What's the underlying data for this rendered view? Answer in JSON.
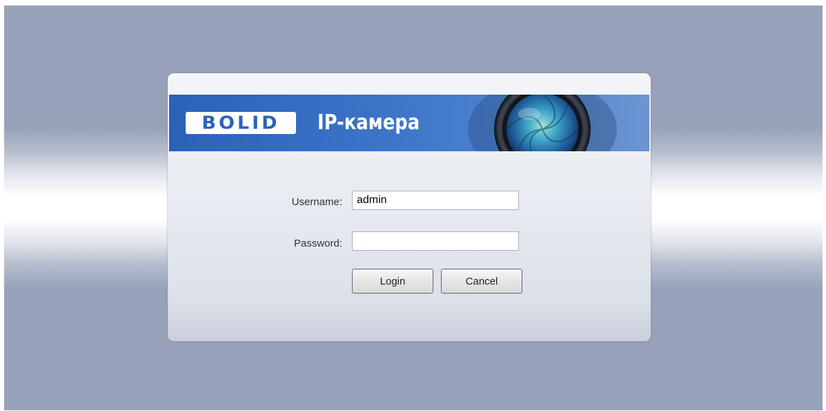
{
  "brand": {
    "logo": "BOLID",
    "title": "IP-камера"
  },
  "form": {
    "username_label": "Username:",
    "username_value": "admin",
    "password_label": "Password:",
    "password_value": "",
    "login_label": "Login",
    "cancel_label": "Cancel"
  },
  "icons": {
    "banner_graphic": "camera-lens-icon"
  },
  "colors": {
    "banner_blue": "#2c61b8",
    "background": "#97a2b8"
  }
}
